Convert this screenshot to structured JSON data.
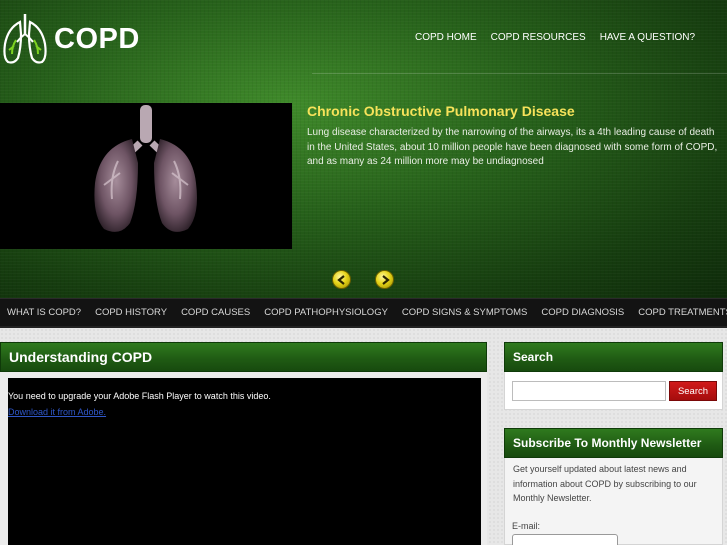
{
  "brand": {
    "name": "COPD",
    "icon": "lungs-icon"
  },
  "top_nav": [
    "COPD HOME",
    "COPD RESOURCES",
    "HAVE A QUESTION?"
  ],
  "slider": {
    "title": "Chronic Obstructive Pulmonary Disease",
    "description": "Lung disease characterized by the narrowing of the airways, its a 4th leading cause of death in the United States, about 10 million people have been diagnosed with some form of COPD, and as many as 24 million more may be undiagnosed",
    "prev_icon": "arrow-left-icon",
    "next_icon": "arrow-right-icon"
  },
  "main_nav": [
    "WHAT IS COPD?",
    "COPD HISTORY",
    "COPD CAUSES",
    "COPD PATHOPHYSIOLOGY",
    "COPD SIGNS & SYMPTOMS",
    "COPD DIAGNOSIS",
    "COPD TREATMENTS"
  ],
  "main": {
    "title": "Understanding COPD",
    "video_message": "You need to upgrade your Adobe Flash Player to watch this video.",
    "video_link": "Download it from Adobe."
  },
  "sidebar": {
    "search_title": "Search",
    "search_placeholder": "",
    "search_button": "Search",
    "newsletter_title": "Subscribe To Monthly Newsletter",
    "newsletter_text": "Get yourself updated about latest news and information about COPD by subscribing to our Monthly Newsletter.",
    "email_label": "E-mail:"
  },
  "colors": {
    "header_green": "#26601a",
    "title_yellow": "#f6e25a",
    "button_red": "#c01414",
    "nav_black": "#131313"
  }
}
